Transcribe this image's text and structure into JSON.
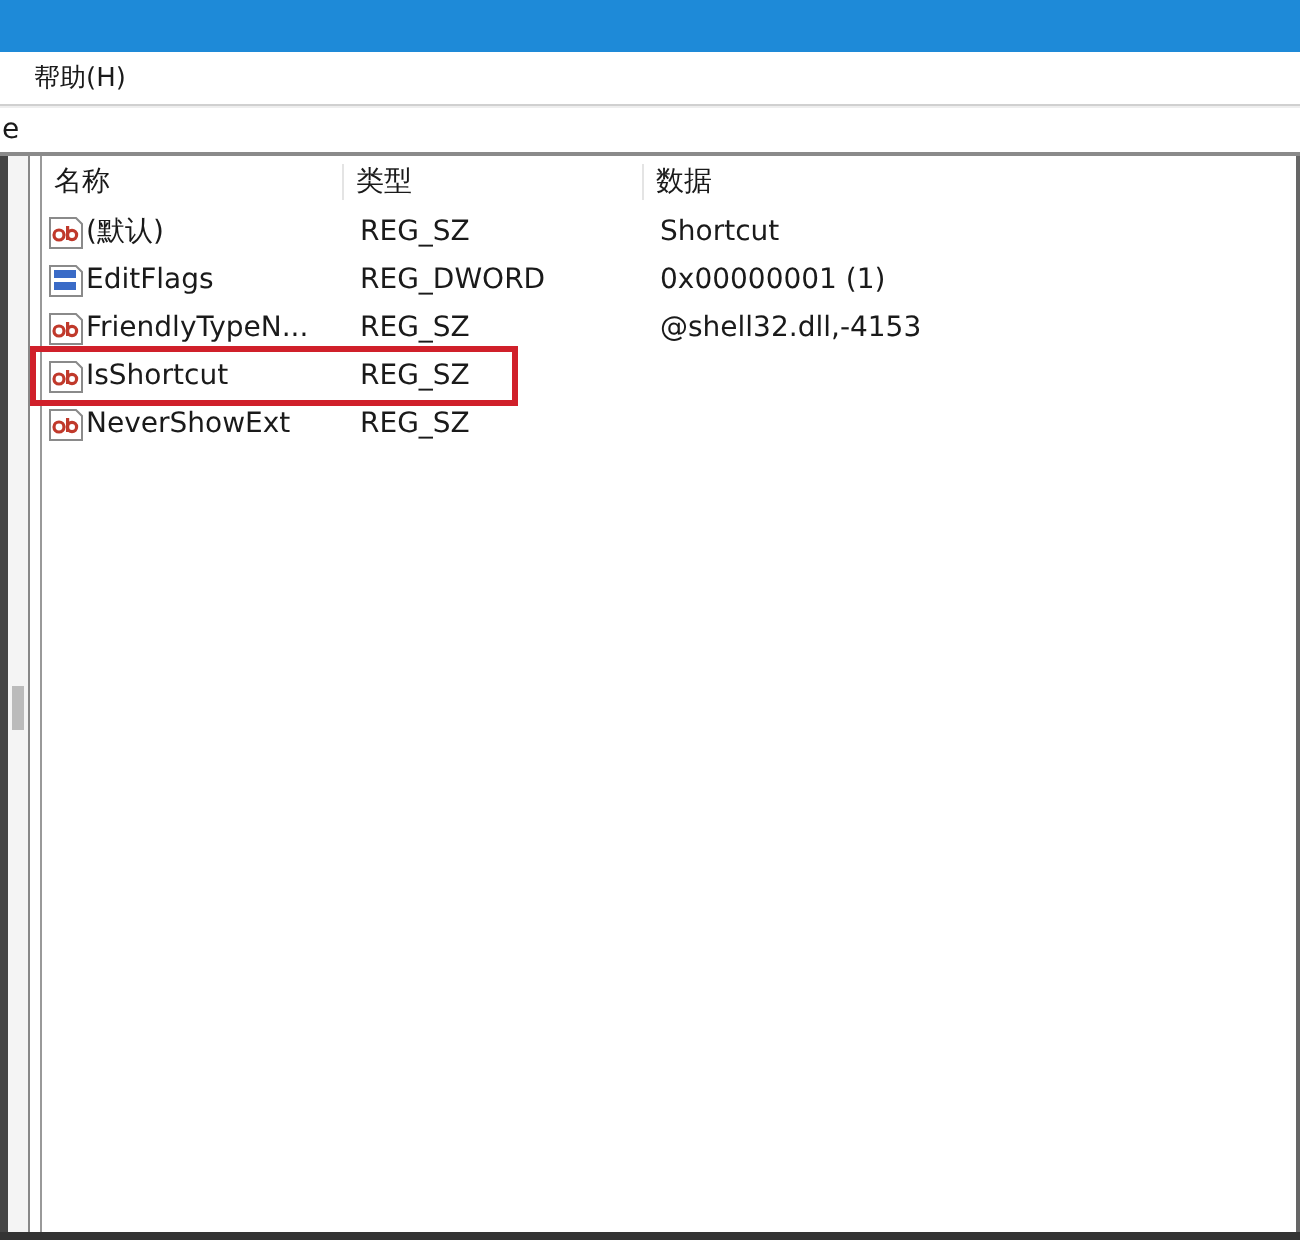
{
  "menu_bar": {
    "items": [
      "帮助(H)"
    ]
  },
  "address_bar": {
    "value": "e"
  },
  "table": {
    "columns": [
      "名称",
      "类型",
      "数据"
    ],
    "rows": [
      {
        "kind": "string",
        "name": "(默认)",
        "type": "REG_SZ",
        "data": "Shortcut",
        "highlighted": false
      },
      {
        "kind": "binary",
        "name": "EditFlags",
        "type": "REG_DWORD",
        "data": "0x00000001 (1)",
        "highlighted": false
      },
      {
        "kind": "string",
        "name": "FriendlyTypeN...",
        "type": "REG_SZ",
        "data": "@shell32.dll,-4153",
        "highlighted": false
      },
      {
        "kind": "string",
        "name": "IsShortcut",
        "type": "REG_SZ",
        "highlighted": true
      },
      {
        "kind": "string",
        "name": "NeverShowExt",
        "type": "REG_SZ",
        "highlighted": false
      }
    ]
  }
}
